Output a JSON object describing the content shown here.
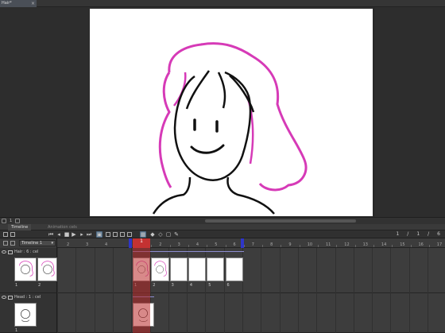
{
  "document": {
    "tab_title": "Hair*",
    "close": "×"
  },
  "statusbar": {
    "zoom": "1"
  },
  "timeline_panel": {
    "tab_label": "Timeline",
    "tab2_label": "Animation cels",
    "frame_current": "1",
    "frame_sep1": "/",
    "frame_end": "1",
    "frame_sep2": "/",
    "frame_total": "6"
  },
  "timeline": {
    "selector": "Timeline 1",
    "playhead_label": "1",
    "ruler_numbers": [
      "1",
      "2",
      "3",
      "4",
      "5",
      "6",
      "7",
      "8",
      "9",
      "10",
      "11",
      "12",
      "13",
      "14",
      "15",
      "16",
      "17"
    ],
    "left_ruler_numbers": [
      "2",
      "3",
      "4"
    ],
    "tracks": [
      {
        "name": "Hair : 6 : cel",
        "thumbs": [
          "1",
          "2"
        ],
        "cells": [
          "1",
          "2",
          "3",
          "4",
          "5",
          "6"
        ]
      },
      {
        "name": "Head : 1 : cel",
        "thumbs": [
          "1"
        ],
        "cells": [
          ""
        ]
      }
    ]
  },
  "colors": {
    "hair_stroke": "#d63ab7",
    "line_stroke": "#111111",
    "playhead": "#c43232",
    "marker": "#2f36c8",
    "active_button": "#4d6a84"
  },
  "icons": [
    "eye-icon",
    "folder-icon",
    "play-icon",
    "stop-icon",
    "prev-frame-icon",
    "next-frame-icon",
    "onion-skin-icon"
  ]
}
